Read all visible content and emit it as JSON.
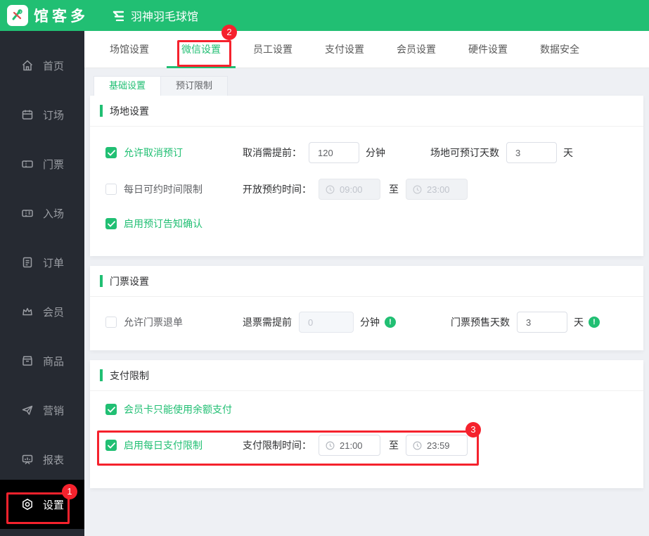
{
  "colors": {
    "brand_green": "#21bf73",
    "annotation_red": "#f5222d",
    "sidebar_bg": "#262a32",
    "active_item_bg": "#000000",
    "content_bg": "#eef0f4"
  },
  "topbar": {
    "brand": "馆客多",
    "venue_title": "羽神羽毛球馆"
  },
  "main_tabs": {
    "items": [
      {
        "label": "场馆设置",
        "active": false
      },
      {
        "label": "微信设置",
        "active": true
      },
      {
        "label": "员工设置",
        "active": false
      },
      {
        "label": "支付设置",
        "active": false
      },
      {
        "label": "会员设置",
        "active": false
      },
      {
        "label": "硬件设置",
        "active": false
      },
      {
        "label": "数据安全",
        "active": false
      }
    ]
  },
  "sub_tabs": {
    "items": [
      {
        "label": "基础设置",
        "active": true
      },
      {
        "label": "预订限制",
        "active": false
      }
    ]
  },
  "sidebar": {
    "items": [
      {
        "label": "首页",
        "icon": "home-icon"
      },
      {
        "label": "订场",
        "icon": "booking-icon"
      },
      {
        "label": "门票",
        "icon": "ticket-icon"
      },
      {
        "label": "入场",
        "icon": "entry-icon"
      },
      {
        "label": "订单",
        "icon": "order-icon"
      },
      {
        "label": "会员",
        "icon": "member-icon"
      },
      {
        "label": "商品",
        "icon": "goods-icon"
      },
      {
        "label": "营销",
        "icon": "marketing-icon"
      },
      {
        "label": "报表",
        "icon": "report-icon"
      },
      {
        "label": "设置",
        "icon": "gear-icon",
        "active": true
      }
    ]
  },
  "venue_section": {
    "title": "场地设置",
    "row_cancel": {
      "checked": true,
      "label": "允许取消预订",
      "before_label": "取消需提前：",
      "before_value": "120",
      "before_unit": "分钟",
      "days_label": "场地可预订天数",
      "days_value": "3",
      "days_unit": "天"
    },
    "row_daily_limit": {
      "checked": false,
      "label": "每日可约时间限制",
      "time_label": "开放预约时间：",
      "time_start": "09:00",
      "to": "至",
      "time_end": "23:00",
      "disabled": true
    },
    "row_notice": {
      "checked": true,
      "label": "启用预订告知确认"
    }
  },
  "ticket_section": {
    "title": "门票设置",
    "row_refund": {
      "checked": false,
      "label": "允许门票退单",
      "before_label": "退票需提前",
      "before_value": "0",
      "before_disabled": true,
      "before_unit": "分钟",
      "presale_label": "门票预售天数",
      "presale_value": "3",
      "presale_unit": "天"
    }
  },
  "payment_section": {
    "title": "支付限制",
    "row_balance": {
      "checked": true,
      "label": "会员卡只能使用余额支付"
    },
    "row_pay_limit": {
      "checked": true,
      "label": "启用每日支付限制",
      "time_label": "支付限制时间：",
      "time_start": "21:00",
      "to": "至",
      "time_end": "23:59"
    }
  },
  "icons": {
    "info_glyph": "!"
  },
  "annotations": {
    "step1": "1",
    "step2": "2",
    "step3": "3"
  }
}
